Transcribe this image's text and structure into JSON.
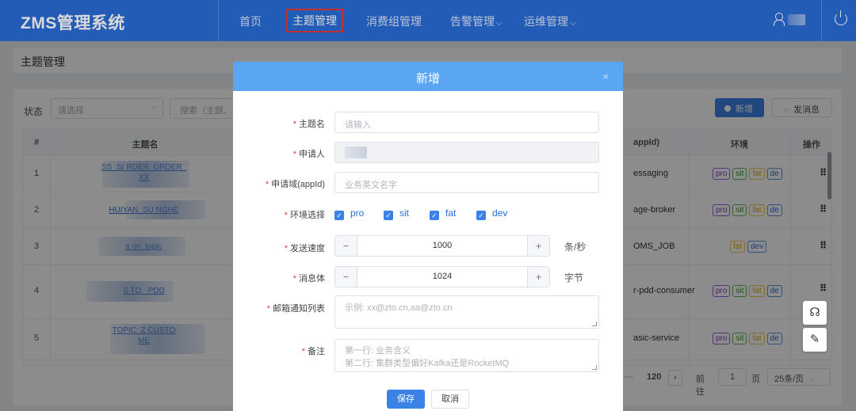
{
  "app": {
    "title": "ZMS管理系统"
  },
  "nav": {
    "items": [
      {
        "label": "首页",
        "caret": ""
      },
      {
        "label": "主题管理",
        "caret": ""
      },
      {
        "label": "消费组管理",
        "caret": ""
      },
      {
        "label": "告警管理",
        "caret": "⌵"
      },
      {
        "label": "运维管理",
        "caret": "⌵"
      }
    ],
    "active": "主题管理"
  },
  "page": {
    "title": "主题管理"
  },
  "filter": {
    "status_label": "状态",
    "status_placeholder": "请选择",
    "search_placeholder": "搜索（主题、",
    "new_label": "新增",
    "send_label": "发消息"
  },
  "table": {
    "headers": {
      "index": "#",
      "topic": "主题名",
      "appid": "appId)",
      "env": "环境",
      "op": "操作"
    },
    "rows": [
      {
        "index": "1",
        "topic_line1": "SS_S(                    RDER_ORDER_",
        "topic_line2": "XX",
        "appid": "essaging",
        "envs": [
          "pro",
          "sit",
          "fat",
          "de"
        ]
      },
      {
        "index": "2",
        "topic_line1": "HUIYAN_SU                      NGHE",
        "topic_line2": "",
        "appid": "age-broker",
        "envs": [
          "pro",
          "sit",
          "fat",
          "de"
        ]
      },
      {
        "index": "3",
        "topic_line1": "s                     on_topic",
        "topic_line2": "",
        "appid": "OMS_JOB",
        "envs": [
          "fat",
          "dev"
        ]
      },
      {
        "index": "4",
        "topic_line1": "S              TO             _PDD",
        "topic_line2": "",
        "appid": "r-pdd-consumer",
        "envs": [
          "pro",
          "sit",
          "fat",
          "de"
        ]
      },
      {
        "index": "5",
        "topic_line1": "TOPIC_Z                       CUSTO",
        "topic_line2": "ME",
        "appid": "asic-service",
        "envs": [
          "pro",
          "sit",
          "fat",
          "de"
        ]
      }
    ],
    "op_icon": "grid-icon"
  },
  "pagination": {
    "dots": "···",
    "last_page": "120",
    "next": "›",
    "goto_label": "前往",
    "page_value": "1",
    "page_label": "页",
    "page_size": "25条/页"
  },
  "dialog": {
    "title": "新增",
    "close": "×",
    "fields": {
      "topic": {
        "label": "主题名",
        "placeholder": "请输入"
      },
      "applicant": {
        "label": "申请人",
        "value": ""
      },
      "appid": {
        "label": "申请域(appId)",
        "placeholder": "业务英文名字"
      },
      "env": {
        "label": "环境选择",
        "options": [
          "pro",
          "sit",
          "fat",
          "dev"
        ],
        "checked": [
          true,
          true,
          true,
          true
        ]
      },
      "speed": {
        "label": "发送速度",
        "value": "1000",
        "unit": "条/秒"
      },
      "msg_size": {
        "label": "消息体",
        "value": "1024",
        "unit": "字节"
      },
      "email": {
        "label": "邮箱通知列表",
        "placeholder": "示例: xx@zto.cn,aa@zto.cn"
      },
      "remark": {
        "label": "备注",
        "placeholder_line1": "第一行: 业务含义",
        "placeholder_line2": "第二行: 集群类型偏好Kafka还是RocketMQ"
      }
    },
    "save_label": "保存",
    "cancel_label": "取消",
    "minus": "−",
    "plus": "+"
  },
  "colors": {
    "primary": "#2a6dd6",
    "header": "#5aa6f2",
    "danger": "#e53935"
  }
}
